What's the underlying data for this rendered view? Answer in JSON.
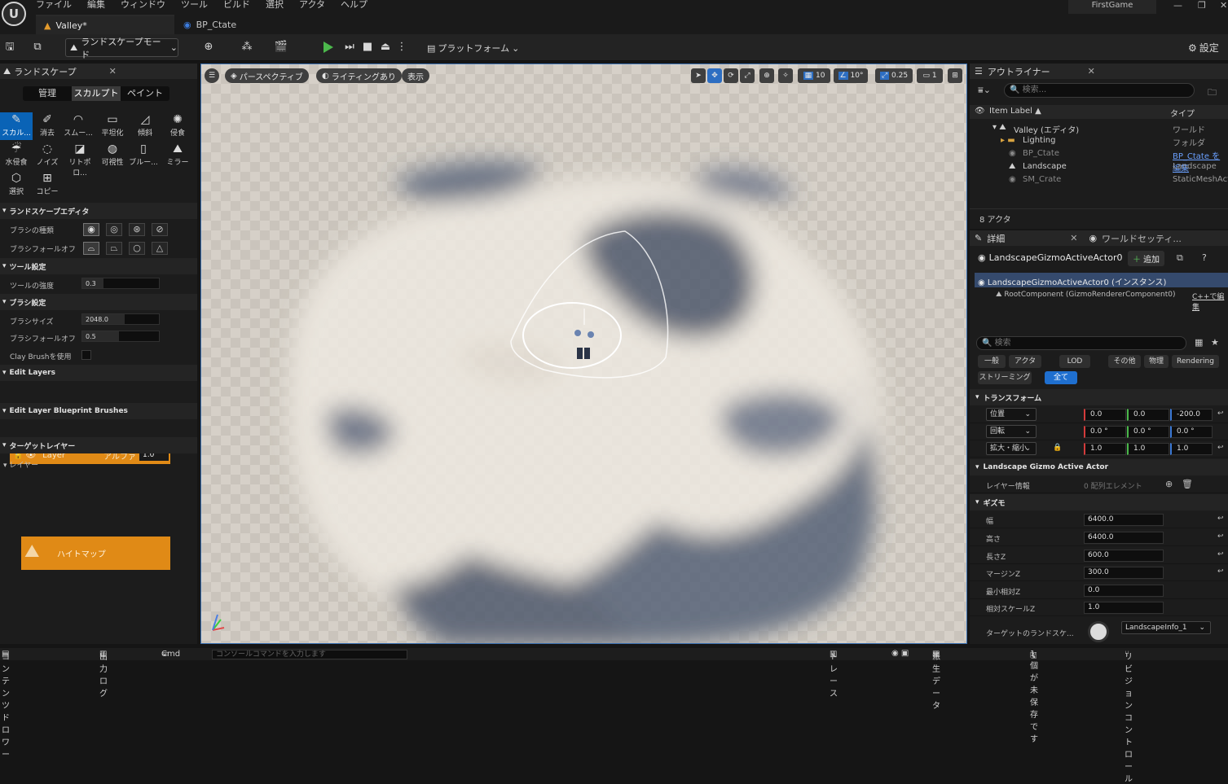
{
  "menu": [
    "ファイル",
    "編集",
    "ウィンドウ",
    "ツール",
    "ビルド",
    "選択",
    "アクタ",
    "ヘルプ"
  ],
  "project_name": "FirstGame",
  "tabs": [
    "Valley*",
    "BP_Ctate"
  ],
  "toolbar": {
    "mode": "ランドスケープモード",
    "platform": "プラットフォーム",
    "settings": "設定"
  },
  "left": {
    "title": "ランドスケープ",
    "modes": [
      "管理",
      "スカルプト",
      "ペイント"
    ],
    "tools": [
      {
        "label": "スカル...",
        "icon": "✎"
      },
      {
        "label": "消去",
        "icon": "✐"
      },
      {
        "label": "スムー...",
        "icon": "◠"
      },
      {
        "label": "平坦化",
        "icon": "▭"
      },
      {
        "label": "傾斜",
        "icon": "◿"
      },
      {
        "label": "侵食",
        "icon": "✺"
      },
      {
        "label": "水侵食",
        "icon": "☔"
      },
      {
        "label": "ノイズ",
        "icon": "◌"
      },
      {
        "label": "リトポロ...",
        "icon": "◪"
      },
      {
        "label": "可視性",
        "icon": "◍"
      },
      {
        "label": "ブルー...",
        "icon": "▯"
      },
      {
        "label": "ミラー",
        "icon": "⛰"
      },
      {
        "label": "選択",
        "icon": "⬡"
      },
      {
        "label": "コピー",
        "icon": "⊞"
      }
    ],
    "editor_section": "ランドスケープエディタ",
    "brush_type": "ブラシの種類",
    "brush_falloff": "ブラシフォールオフ",
    "tool_settings": "ツール設定",
    "tool_strength": {
      "label": "ツールの強度",
      "value": "0.3"
    },
    "brush_settings": "ブラシ設定",
    "brush_size": {
      "label": "ブラシサイズ",
      "value": "2048.0"
    },
    "brush_falloff_val": {
      "label": "ブラシフォールオフ",
      "value": "0.5"
    },
    "clay_brush": "Clay Brushを使用",
    "edit_layers": "Edit Layers",
    "layer": {
      "name": "Layer",
      "alpha_label": "アルファ",
      "alpha": "1.0"
    },
    "bp_brushes": "Edit Layer Blueprint Brushes",
    "target_layers": "ターゲットレイヤー",
    "layers_label": "レイヤー",
    "heightmap": "ハイトマップ"
  },
  "viewport": {
    "perspective": "パースペクティブ",
    "lighting": "ライティングあり",
    "show": "表示",
    "grid": "10",
    "angle": "10°",
    "scale": "0.25",
    "cam": "1"
  },
  "outliner": {
    "title": "アウトライナー",
    "search_placeholder": "検索...",
    "col_label": "Item Label ▲",
    "col_type": "タイプ",
    "rows": [
      {
        "label": "Valley (エディタ)",
        "type": "ワールド"
      },
      {
        "label": "Lighting",
        "type": "フォルダ"
      },
      {
        "label": "BP_Ctate",
        "type": "BP_Ctate を編集"
      },
      {
        "label": "Landscape",
        "type": "Landscape"
      },
      {
        "label": "SM_Crate",
        "type": "StaticMeshActor"
      }
    ],
    "count": "8 アクタ"
  },
  "details": {
    "tab": "詳細",
    "tab2": "ワールドセッティ...",
    "actor_name": "LandscapeGizmoActiveActor0",
    "add": "追加",
    "instance": "LandscapeGizmoActiveActor0 (インスタンス)",
    "root": "RootComponent (GizmoRendererComponent0)",
    "root_link": "C++で編集",
    "search_placeholder": "検索",
    "cats": [
      "一般",
      "アクタ",
      "LOD",
      "その他",
      "物理",
      "Rendering",
      "ストリーミング",
      "全て"
    ],
    "transform": "トランスフォーム",
    "loc": {
      "label": "位置",
      "x": "0.0",
      "y": "0.0",
      "z": "-200.0"
    },
    "rot": {
      "label": "回転",
      "x": "0.0 °",
      "y": "0.0 °",
      "z": "0.0 °"
    },
    "scale": {
      "label": "拡大・縮小",
      "x": "1.0",
      "y": "1.0",
      "z": "1.0"
    },
    "gizmo_actor": "Landscape Gizmo Active Actor",
    "layer_info": {
      "label": "レイヤー情報",
      "value": "0 配列エレメント"
    },
    "gizmo": "ギズモ",
    "props": [
      {
        "label": "幅",
        "value": "6400.0"
      },
      {
        "label": "高さ",
        "value": "6400.0"
      },
      {
        "label": "長さZ",
        "value": "600.0"
      },
      {
        "label": "マージンZ",
        "value": "300.0"
      },
      {
        "label": "最小相対Z",
        "value": "0.0"
      },
      {
        "label": "相対スケールZ",
        "value": "1.0"
      }
    ],
    "target_landscape": {
      "label": "ターゲットのランドスケ...",
      "value": "LandscapeInfo_1"
    }
  },
  "status": {
    "content": "コンテンツドロワー",
    "output": "出力ログ",
    "cmd": "Cmd",
    "console_placeholder": "コンソールコマンドを入力します",
    "trace": "トレース",
    "derived": "派生データ",
    "unsaved": "1個が未保存です",
    "revision": "リビジョンコントロール"
  }
}
